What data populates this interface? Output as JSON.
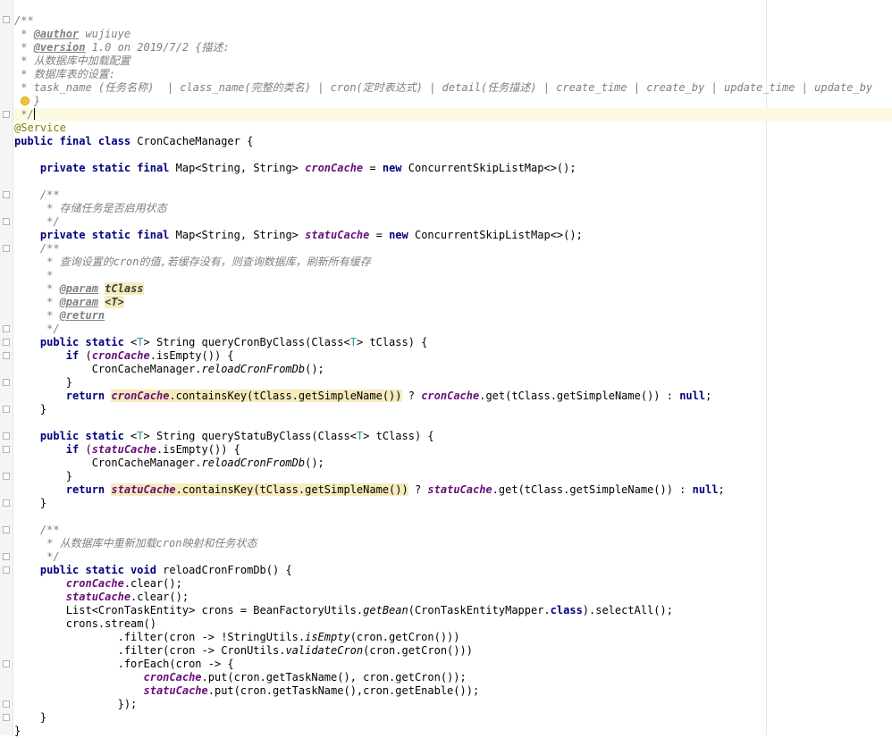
{
  "editor": {
    "lines": [
      "/**",
      " * ",
      " * ",
      " * ",
      " * ",
      "    @Service",
      "public final class CronCacheManager {",
      "    private static final Map<String, String> cronCache = new ConcurrentSkipListMap<>();",
      "    /**",
      "     * 存储任务是否启用状态",
      "     */",
      "    private static final Map<String, String> statuCache = new ConcurrentSkipListMap<>();",
      "    /**",
      "     * 查询设置的cron的值,若缓存没有，则查询数据库，刷新所有缓存",
      "     *",
      "     * @param tClass",
      "     * @param <T>",
      "     * @return",
      "     */",
      "    public static <T> String queryCronByClass(Class<T> tClass) {",
      "        if (cronCache.isEmpty()) {",
      "            CronCacheManager.reloadCronFromDb();",
      "        }",
      "        return cronCache.containsKey(tClass.getSimpleName()) ? cronCache.get(tClass.getSimpleName()) : null;",
      "    }",
      "    public static <T> String queryStatuByClass(Class<T> tClass) {",
      "        if (statuCache.isEmpty()) {",
      "            CronCacheManager.reloadCronFromDb();",
      "        }",
      "        return statuCache.containsKey(tClass.getSimpleName()) ? statuCache.get(tClass.getSimpleName()) : null;",
      "    }",
      "    /**",
      "     * 从数据库中重新加载cron映射和任务状态",
      "     */",
      "    public static void reloadCronFromDb() {",
      "        cronCache.clear();",
      "        statuCache.clear();",
      "        List<CronTaskEntity> crons = BeanFactoryUtils.getBean(CronTaskEntityMapper.class).selectAll();",
      "        crons.stream()",
      "                .filter(cron -> !StringUtils.isEmpty(cron.getCron()))",
      "                .filter(cron -> CronUtils.validateCron(cron.getCron()))",
      "                .forEach(cron -> {",
      "                    cronCache.put(cron.getTaskName(), cron.getCron());",
      "                    statuCache.put(cron.getTaskName(),cron.getEnable());",
      "                });",
      "    }",
      "}"
    ],
    "header_comment": {
      "author_tag": "@author",
      "author_value": " wujiuye",
      "version_tag": "@version",
      "version_value": " 1.0 on 2019/7/2 {",
      "version_desc": "描述:",
      "line3": "从数据库中加载配置",
      "line4": "数据库表的设置:",
      "columns": "task_name (任务名称)  | class_name(完整的类名) | cron(定时表达式) | detail(任务描述) | create_time | create_by | update_time | update_by",
      "brace": "}",
      "end": " */"
    }
  }
}
